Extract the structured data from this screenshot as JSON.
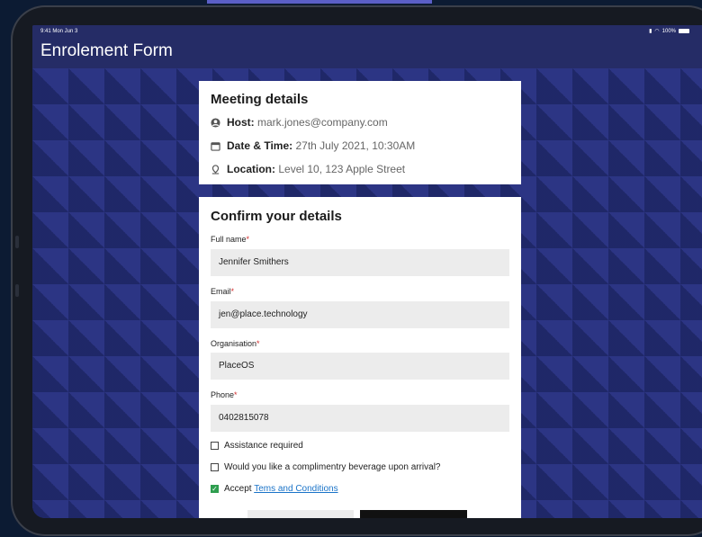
{
  "status": {
    "time": "9:41 Mon Jun 3",
    "battery": "100%"
  },
  "header": {
    "title": "Enrolement Form"
  },
  "meeting": {
    "title": "Meeting details",
    "host_label": "Host:",
    "host_value": "mark.jones@company.com",
    "datetime_label": "Date & Time:",
    "datetime_value": "27th July 2021, 10:30AM",
    "location_label": "Location:",
    "location_value": "Level 10, 123 Apple Street"
  },
  "form": {
    "title": "Confirm your details",
    "fullname_label": "Full name",
    "fullname_value": "Jennifer Smithers",
    "email_label": "Email",
    "email_value": "jen@place.technology",
    "org_label": "Organisation",
    "org_value": "PlaceOS",
    "phone_label": "Phone",
    "phone_value": "0402815078",
    "required_mark": "*",
    "assist_label": "Assistance required",
    "beverage_label": "Would you like a complimentry beverage upon arrival?",
    "accept_label": "Accept",
    "terms_label": "Tems and Conditions"
  }
}
